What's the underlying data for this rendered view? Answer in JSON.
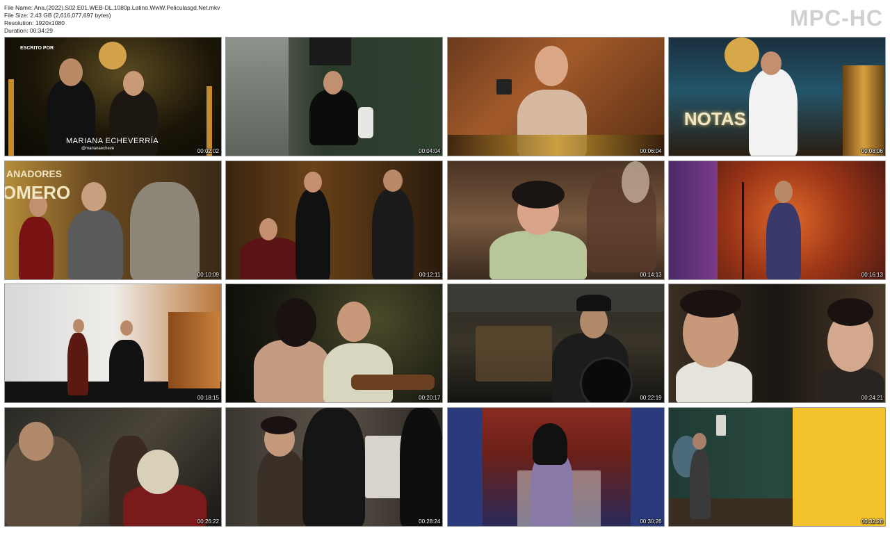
{
  "file_info": {
    "name": "File Name: Ana.(2022).S02.E01.WEB-DL.1080p.Latino.WwW.Peliculasgd.Net.mkv",
    "size": "File Size: 2.43 GB (2,616,077,697 bytes)",
    "resolution": "Resolution: 1920x1080",
    "duration": "Duration: 00:34:29"
  },
  "logo": "MPC-HC",
  "colors": {
    "background": "#ffffff",
    "timestamp": "#ffffff",
    "logo": "#d0d0d0"
  },
  "thumbnails": [
    {
      "time": "00:02:02",
      "overlay_top": "ESCRITO POR",
      "overlay_name": "MARIANA ECHEVERRÍA",
      "overlay_handle": "@marianaecheve"
    },
    {
      "time": "00:04:04"
    },
    {
      "time": "00:06:04"
    },
    {
      "time": "00:08:06",
      "overlay_name": "NOTAS"
    },
    {
      "time": "00:10:09",
      "overlay_top": "ANADORES",
      "overlay_name": "OMERO"
    },
    {
      "time": "00:12:11"
    },
    {
      "time": "00:14:13"
    },
    {
      "time": "00:16:13"
    },
    {
      "time": "00:18:15"
    },
    {
      "time": "00:20:17"
    },
    {
      "time": "00:22:19"
    },
    {
      "time": "00:24:21"
    },
    {
      "time": "00:26:22"
    },
    {
      "time": "00:28:24"
    },
    {
      "time": "00:30:26"
    },
    {
      "time": "00:32:28"
    }
  ]
}
